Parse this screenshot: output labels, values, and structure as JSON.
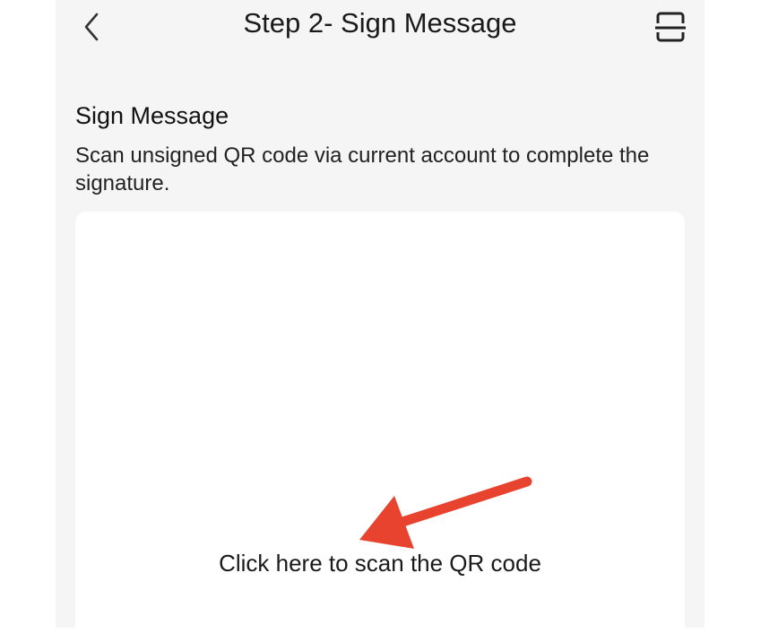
{
  "header": {
    "title": "Step 2- Sign Message",
    "back_icon": "chevron-left-icon",
    "scan_icon": "scan-icon"
  },
  "content": {
    "section_title": "Sign Message",
    "description": "Scan unsigned QR code via current account to complete the signature.",
    "scan_prompt": "Click here to scan the QR code"
  },
  "annotation": {
    "arrow_color": "#e8432e"
  },
  "colors": {
    "background": "#f5f5f5",
    "card": "#ffffff",
    "text": "#1a1a1a"
  }
}
